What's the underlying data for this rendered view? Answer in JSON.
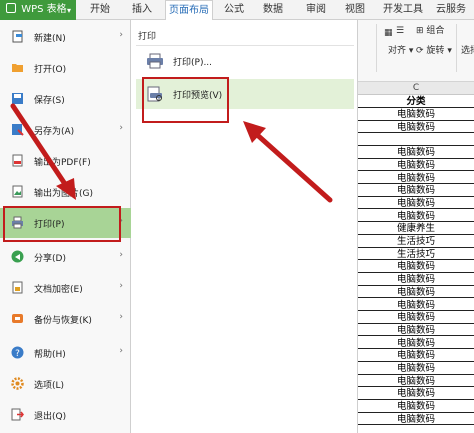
{
  "app": {
    "title": "WPS 表格"
  },
  "tabs": [
    "开始",
    "插入",
    "页面布局",
    "公式",
    "数据",
    "审阅",
    "视图",
    "开发工具",
    "云服务"
  ],
  "active_tab": "页面布局",
  "ribbon": {
    "combine_label": "组合",
    "align_label": "对齐",
    "rotate_label": "旋转",
    "select_label": "选择"
  },
  "file_menu": {
    "items": [
      {
        "label": "新建(N)",
        "icon": "new-file-icon",
        "has_submenu": true
      },
      {
        "label": "打开(O)",
        "icon": "folder-open-icon",
        "has_submenu": false
      },
      {
        "label": "保存(S)",
        "icon": "floppy-disk-icon",
        "has_submenu": false
      },
      {
        "label": "另存为(A)",
        "icon": "save-as-icon",
        "has_submenu": true
      },
      {
        "label": "输出为PDF(F)",
        "icon": "pdf-icon",
        "has_submenu": false
      },
      {
        "label": "输出为图片(G)",
        "icon": "image-export-icon",
        "has_submenu": false
      },
      {
        "label": "打印(P)",
        "icon": "printer-icon",
        "has_submenu": true,
        "selected": true
      },
      {
        "label": "分享(D)",
        "icon": "share-icon",
        "has_submenu": true
      },
      {
        "label": "文档加密(E)",
        "icon": "lock-icon",
        "has_submenu": true
      },
      {
        "label": "备份与恢复(K)",
        "icon": "backup-icon",
        "has_submenu": true
      },
      {
        "label": "帮助(H)",
        "icon": "help-icon",
        "has_submenu": true
      },
      {
        "label": "选项(L)",
        "icon": "gear-icon",
        "has_submenu": false
      },
      {
        "label": "退出(Q)",
        "icon": "exit-icon",
        "has_submenu": false
      }
    ]
  },
  "print_submenu": {
    "title": "打印",
    "items": [
      {
        "label": "打印(P)...",
        "icon": "printer-icon"
      },
      {
        "label": "打印预览(V)",
        "icon": "print-preview-icon",
        "hover": true
      }
    ]
  },
  "sheet": {
    "column_header": "C",
    "header_cell": "分类",
    "cells": [
      "电脑数码",
      "电脑数码",
      "",
      "电脑数码",
      "电脑数码",
      "电脑数码",
      "电脑数码",
      "电脑数码",
      "电脑数码",
      "健康养生",
      "生活技巧",
      "生活技巧",
      "电脑数码",
      "电脑数码",
      "电脑数码",
      "电脑数码",
      "电脑数码",
      "电脑数码",
      "电脑数码",
      "电脑数码",
      "电脑数码",
      "电脑数码",
      "电脑数码",
      "电脑数码",
      "电脑数码"
    ]
  },
  "colors": {
    "accent_green": "#3f9a3c",
    "selected_green": "#a8d496",
    "hover_green": "#e3f1d8",
    "annotation_red": "#c21c1c"
  }
}
